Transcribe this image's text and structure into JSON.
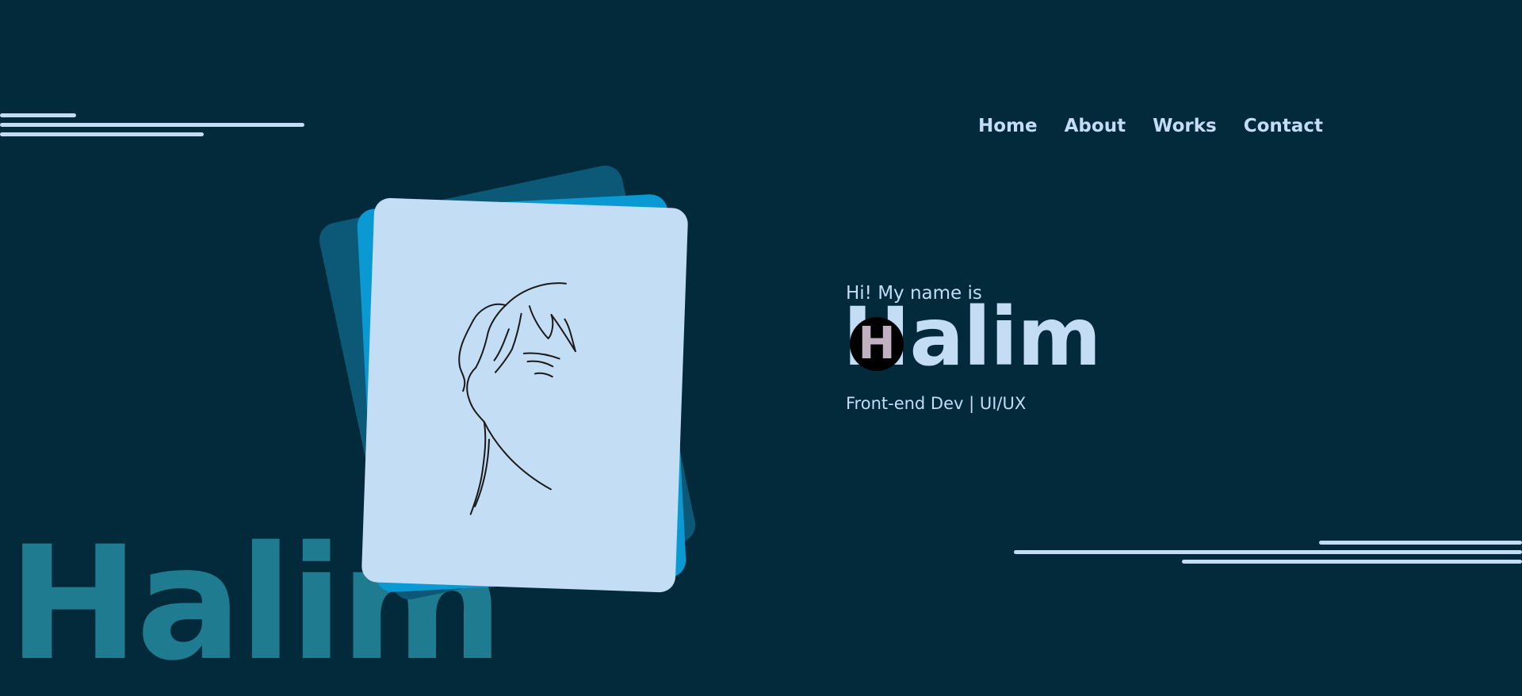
{
  "nav": {
    "items": [
      {
        "label": "Home"
      },
      {
        "label": "About"
      },
      {
        "label": "Works"
      },
      {
        "label": "Contact"
      }
    ]
  },
  "hero": {
    "greeting": "Hi! My name is",
    "name": "Halim",
    "role": "Front-end Dev | UI/UX",
    "background_name": "Halim",
    "cursor_letter": "H"
  },
  "colors": {
    "background": "#022a3a",
    "text": "#c3ddf5",
    "card_back": "#0b5877",
    "card_mid": "#0b99d3",
    "card_front": "#c3ddf5",
    "bg_name": "#1f7b8f"
  },
  "icons": {
    "portrait": "sketch-portrait",
    "cursor": "circle-cursor"
  }
}
